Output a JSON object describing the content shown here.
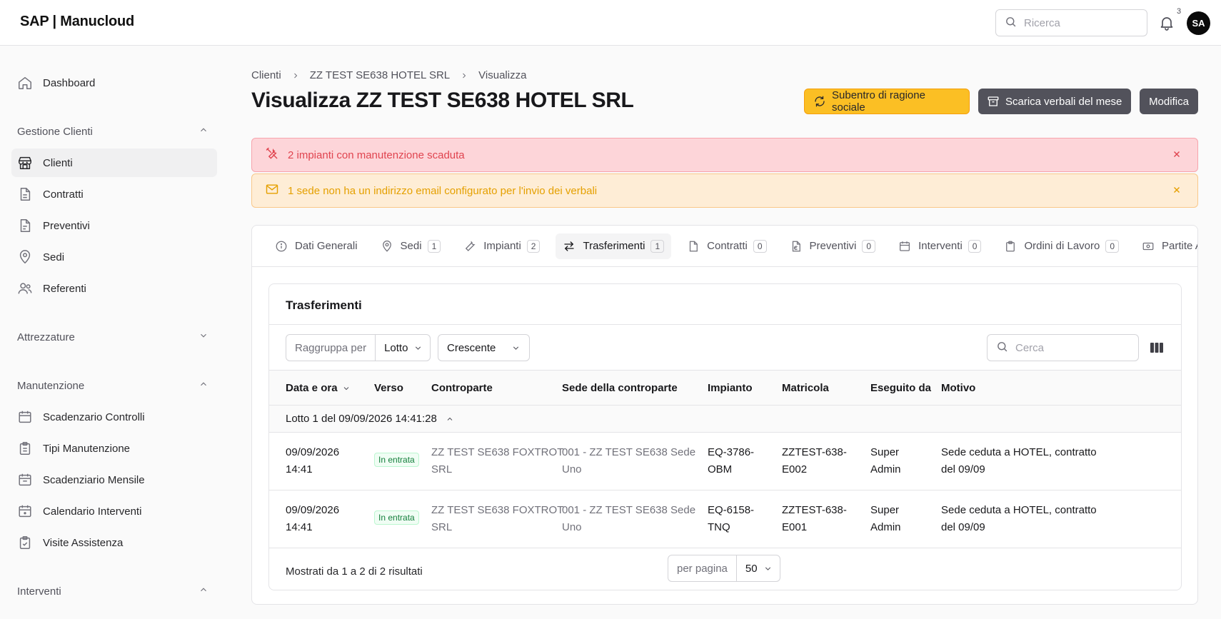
{
  "app": {
    "logo": "SAP | Manucloud"
  },
  "topbar": {
    "search_placeholder": "Ricerca",
    "notification_count": "3",
    "avatar_initials": "SA"
  },
  "sidebar": {
    "dashboard": "Dashboard",
    "sections": {
      "gestione_clienti": "Gestione Clienti",
      "attrezzature": "Attrezzature",
      "manutenzione": "Manutenzione",
      "interventi": "Interventi"
    },
    "gestione_items": [
      "Clienti",
      "Contratti",
      "Preventivi",
      "Sedi",
      "Referenti"
    ],
    "manutenzione_items": [
      "Scadenzario Controlli",
      "Tipi Manutenzione",
      "Scadenziario Mensile",
      "Calendario Interventi",
      "Visite Assistenza"
    ],
    "active_item": "Clienti"
  },
  "breadcrumb": [
    "Clienti",
    "ZZ TEST SE638 HOTEL SRL",
    "Visualizza"
  ],
  "page_title": "Visualizza ZZ TEST SE638 HOTEL SRL",
  "actions": {
    "subentro": "Subentro di ragione sociale",
    "scarica": "Scarica verbali del mese",
    "modifica": "Modifica"
  },
  "alerts": {
    "maintenance": "2 impianti con manutenzione scaduta",
    "email": "1 sede non ha un indirizzo email configurato per l'invio dei verbali"
  },
  "tabs": [
    {
      "label": "Dati Generali",
      "count": ""
    },
    {
      "label": "Sedi",
      "count": "1"
    },
    {
      "label": "Impianti",
      "count": "2"
    },
    {
      "label": "Trasferimenti",
      "count": "1"
    },
    {
      "label": "Contratti",
      "count": "0"
    },
    {
      "label": "Preventivi",
      "count": "0"
    },
    {
      "label": "Interventi",
      "count": "0"
    },
    {
      "label": "Ordini di Lavoro",
      "count": "0"
    },
    {
      "label": "Partite Aper",
      "count": ""
    }
  ],
  "active_tab": "Trasferimenti",
  "transfers": {
    "title": "Trasferimenti",
    "group_by_label": "Raggruppa per",
    "group_by_value": "Lotto",
    "sort_value": "Crescente",
    "search_placeholder": "Cerca",
    "columns": [
      "Data e ora",
      "Verso",
      "Controparte",
      "Sede della controparte",
      "Impianto",
      "Matricola",
      "Eseguito da",
      "Motivo"
    ],
    "group_header": "Lotto 1 del 09/09/2026 14:41:28",
    "rows": [
      {
        "date": "09/09/2026",
        "time": "14:41",
        "verso": "In entrata",
        "controparte_1": "ZZ TEST SE638 FOXTROT",
        "controparte_2": "SRL",
        "sede_1": "001 - ZZ TEST SE638 Sede",
        "sede_2": "Uno",
        "impianto_1": "EQ-3786-",
        "impianto_2": "OBM",
        "matricola_1": "ZZTEST-638-",
        "matricola_2": "E002",
        "eseguito_1": "Super",
        "eseguito_2": "Admin",
        "motivo_1": "Sede ceduta a HOTEL, contratto",
        "motivo_2": "del 09/09"
      },
      {
        "date": "09/09/2026",
        "time": "14:41",
        "verso": "In entrata",
        "controparte_1": "ZZ TEST SE638 FOXTROT",
        "controparte_2": "SRL",
        "sede_1": "001 - ZZ TEST SE638 Sede",
        "sede_2": "Uno",
        "impianto_1": "EQ-6158-",
        "impianto_2": "TNQ",
        "matricola_1": "ZZTEST-638-",
        "matricola_2": "E001",
        "eseguito_1": "Super",
        "eseguito_2": "Admin",
        "motivo_1": "Sede ceduta a HOTEL, contratto",
        "motivo_2": "del 09/09"
      }
    ],
    "results_text": "Mostrati da 1 a 2 di 2 risultati",
    "per_page_label": "per pagina",
    "per_page_value": "50"
  },
  "colors": {
    "accent_yellow": "#fbbf24",
    "dark_button": "#52525b",
    "alert_red": "#e0444f",
    "alert_yellow": "#e5a000",
    "badge_green": "#15803d"
  }
}
